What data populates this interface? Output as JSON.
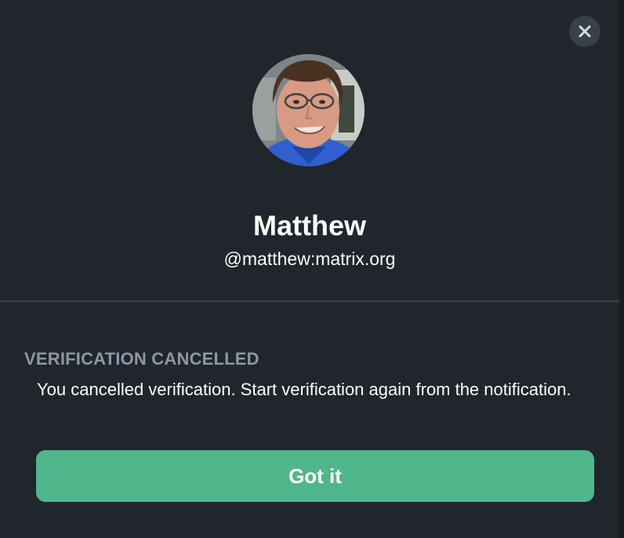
{
  "dialog": {
    "close_icon": "close-icon"
  },
  "user": {
    "avatar_icon": "user-avatar-photo",
    "display_name": "Matthew",
    "user_id": "@matthew:matrix.org"
  },
  "verification": {
    "heading": "VERIFICATION CANCELLED",
    "message": "You cancelled verification. Start verification again from the notification.",
    "button_label": "Got it"
  },
  "colors": {
    "background": "#21262c",
    "accent": "#50b68b",
    "heading": "#8d97a5",
    "divider": "#3d434b",
    "close_button": "#394049"
  }
}
